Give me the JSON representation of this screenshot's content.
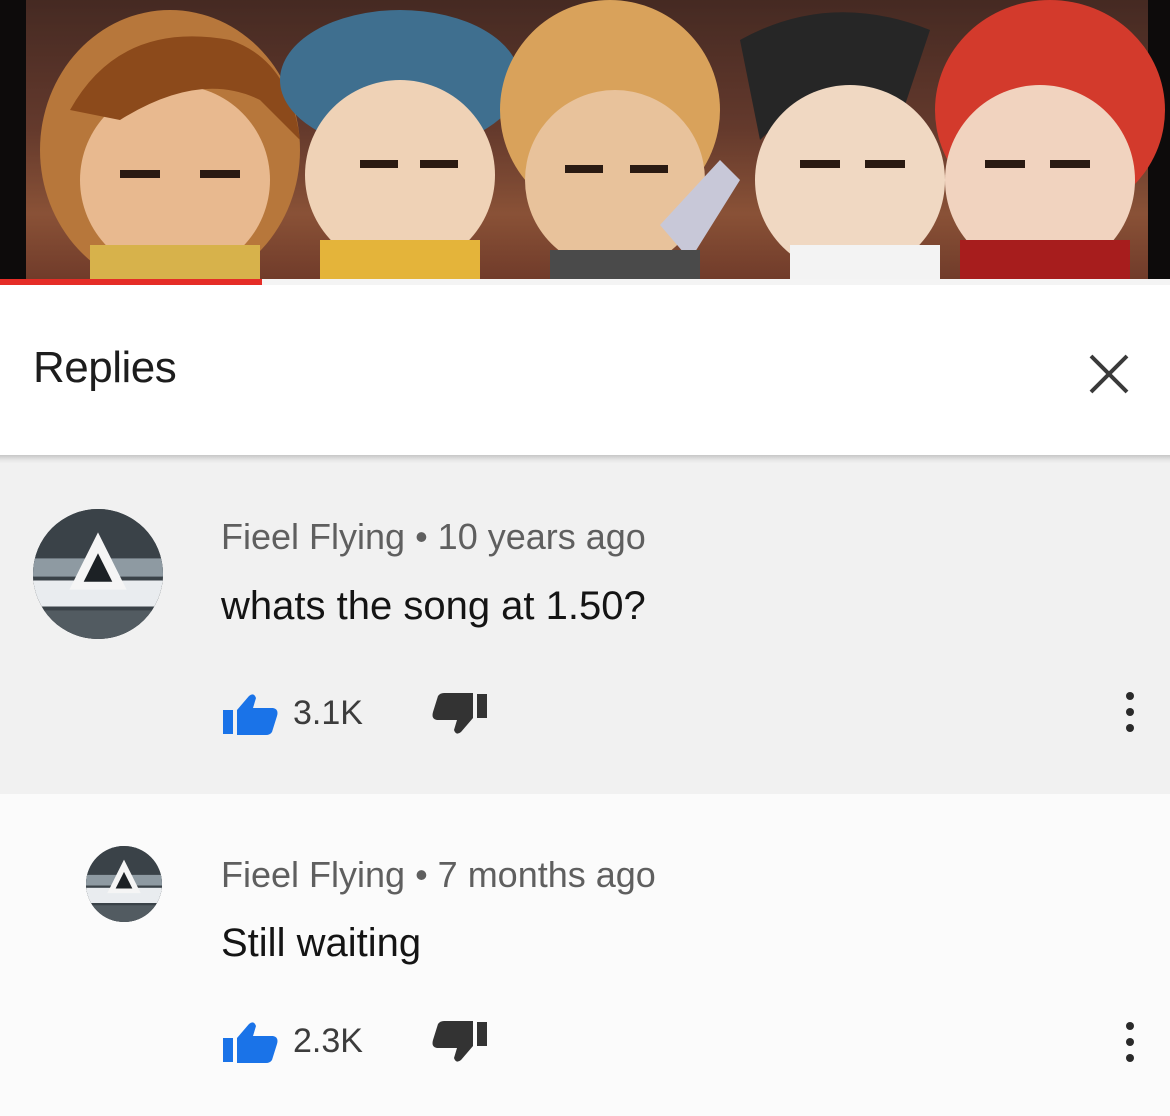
{
  "replies_header": {
    "title": "Replies"
  },
  "comments": [
    {
      "author": "Fieel Flying",
      "separator": "•",
      "time": "10 years ago",
      "text": "whats the song at 1.50?",
      "likes": "3.1K"
    },
    {
      "author": "Fieel Flying",
      "separator": "•",
      "time": "7 months ago",
      "text": "Still waiting",
      "likes": "2.3K"
    }
  ],
  "icons": {
    "close": "close-icon",
    "like": "thumbs-up-icon",
    "dislike": "thumbs-down-icon",
    "more": "more-vert-icon"
  },
  "colors": {
    "like_blue": "#1a73e8",
    "progress_red": "#e52d27",
    "text_primary": "#141414",
    "text_secondary": "#5f5f5f"
  }
}
